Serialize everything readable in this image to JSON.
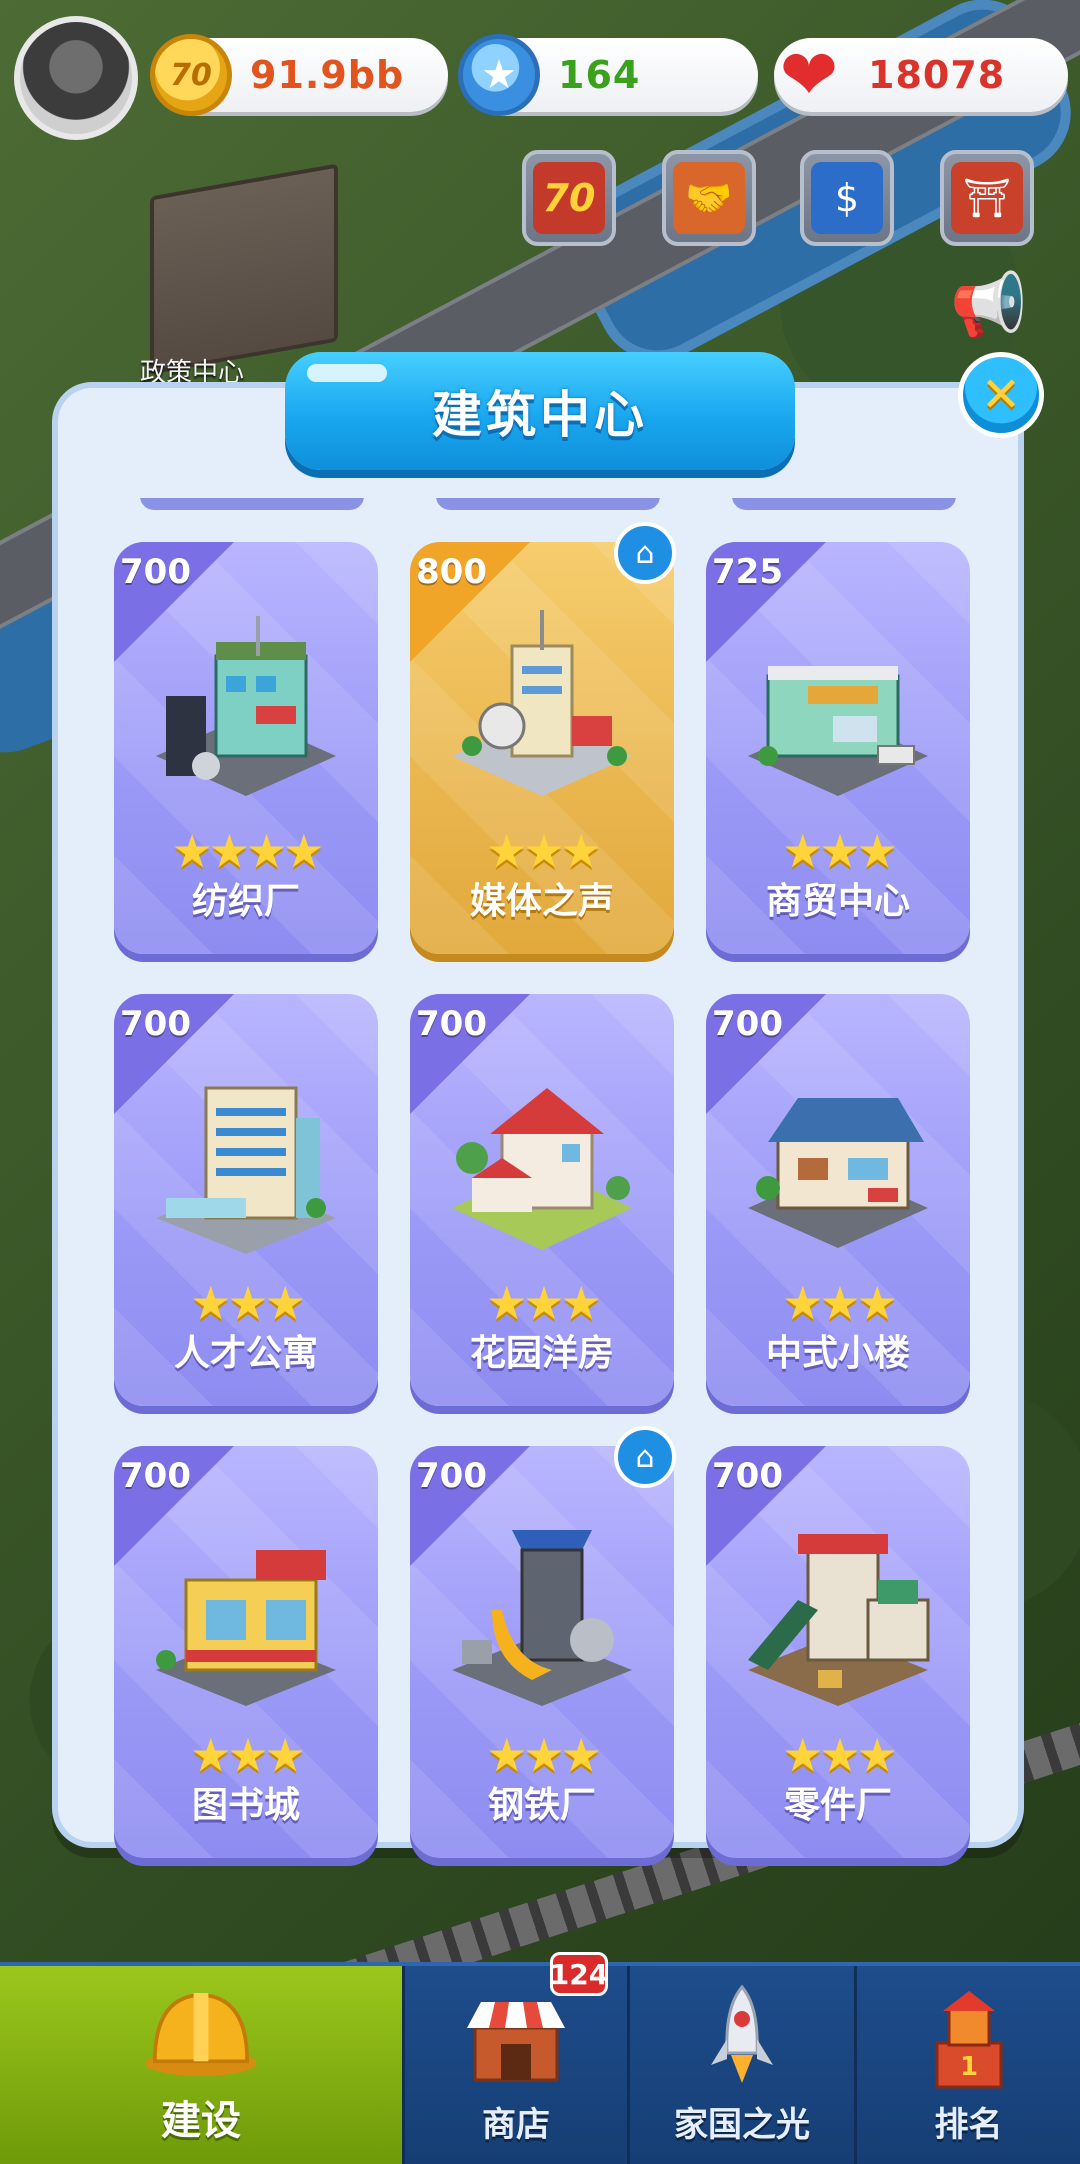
{
  "hud": {
    "coins": "91.9bb",
    "gems": "164",
    "hearts": "18078",
    "coin_icon_text": "70",
    "event_badge_text": "70"
  },
  "background": {
    "building_label": "政策中心"
  },
  "modal": {
    "title": "建筑中心",
    "close_icon": "close-icon"
  },
  "buildings": [
    {
      "price": "700",
      "name": "纺织厂",
      "stars": 4,
      "selected": false,
      "home": false
    },
    {
      "price": "800",
      "name": "媒体之声",
      "stars": 3,
      "selected": true,
      "home": true
    },
    {
      "price": "725",
      "name": "商贸中心",
      "stars": 3,
      "selected": false,
      "home": false
    },
    {
      "price": "700",
      "name": "人才公寓",
      "stars": 3,
      "selected": false,
      "home": false
    },
    {
      "price": "700",
      "name": "花园洋房",
      "stars": 3,
      "selected": false,
      "home": false
    },
    {
      "price": "700",
      "name": "中式小楼",
      "stars": 3,
      "selected": false,
      "home": false
    },
    {
      "price": "700",
      "name": "图书城",
      "stars": 3,
      "selected": false,
      "home": false
    },
    {
      "price": "700",
      "name": "钢铁厂",
      "stars": 3,
      "selected": false,
      "home": true
    },
    {
      "price": "700",
      "name": "零件厂",
      "stars": 3,
      "selected": false,
      "home": false
    }
  ],
  "nav": {
    "items": [
      {
        "label": "建设",
        "icon": "hard-hat-icon",
        "active": true
      },
      {
        "label": "商店",
        "icon": "shop-icon",
        "active": false
      },
      {
        "label": "家国之光",
        "icon": "rocket-icon",
        "active": false
      },
      {
        "label": "排名",
        "icon": "trophy-icon",
        "active": false
      }
    ],
    "shop_badge": "124"
  },
  "colors": {
    "card": "#9c9af7",
    "card_selected": "#eab750",
    "title_bar": "#1aa7ef",
    "nav_active": "#8db514"
  }
}
